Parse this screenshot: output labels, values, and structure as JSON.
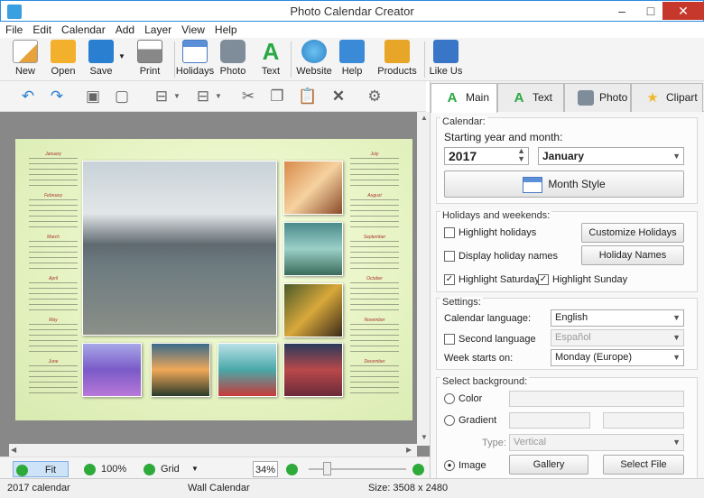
{
  "window": {
    "title": "Photo Calendar Creator"
  },
  "menu": [
    "File",
    "Edit",
    "Calendar",
    "Add",
    "Layer",
    "View",
    "Help"
  ],
  "toolbar": [
    {
      "label": "New",
      "icon": "new-document-icon"
    },
    {
      "label": "Open",
      "icon": "open-folder-icon"
    },
    {
      "label": "Save",
      "icon": "save-floppy-icon"
    },
    {
      "label": "Print",
      "icon": "printer-icon"
    },
    {
      "label": "Holidays",
      "icon": "holidays-calendar-icon"
    },
    {
      "label": "Photo",
      "icon": "camera-icon"
    },
    {
      "label": "Text",
      "icon": "text-a-icon"
    },
    {
      "label": "Website",
      "icon": "globe-icon"
    },
    {
      "label": "Help",
      "icon": "help-book-icon"
    },
    {
      "label": "Products",
      "icon": "products-box-icon"
    },
    {
      "label": "Like Us",
      "icon": "thumbs-up-icon"
    }
  ],
  "tabs": [
    {
      "label": "Main",
      "icon": "text-a-icon"
    },
    {
      "label": "Text",
      "icon": "text-a-icon"
    },
    {
      "label": "Photo",
      "icon": "camera-icon"
    },
    {
      "label": "Clipart",
      "icon": "star-icon"
    }
  ],
  "calendar": {
    "section": "Calendar:",
    "start_label": "Starting year and month:",
    "year": "2017",
    "month": "January",
    "month_style": "Month Style"
  },
  "holidays": {
    "section": "Holidays and weekends:",
    "highlight_holidays": "Highlight holidays",
    "display_names": "Display holiday names",
    "highlight_saturday": "Highlight Saturday",
    "highlight_sunday": "Highlight Sunday",
    "customize": "Customize Holidays",
    "names": "Holiday Names"
  },
  "settings": {
    "section": "Settings:",
    "language_label": "Calendar language:",
    "language": "English",
    "second_label": "Second language",
    "second": "Español",
    "week_label": "Week starts on:",
    "week": "Monday (Europe)"
  },
  "background": {
    "section": "Select background:",
    "color": "Color",
    "gradient": "Gradient",
    "type_label": "Type:",
    "type": "Vertical",
    "image": "Image",
    "gallery": "Gallery",
    "select_file": "Select File"
  },
  "zoom": {
    "fit": "Fit",
    "hundred": "100%",
    "grid": "Grid",
    "level": "34%"
  },
  "status": {
    "project": "2017 calendar",
    "type": "Wall Calendar",
    "size": "Size: 3508 x 2480"
  },
  "months_left": [
    "January",
    "February",
    "March",
    "April",
    "May",
    "June"
  ],
  "months_right": [
    "July",
    "August",
    "September",
    "October",
    "November",
    "December"
  ]
}
